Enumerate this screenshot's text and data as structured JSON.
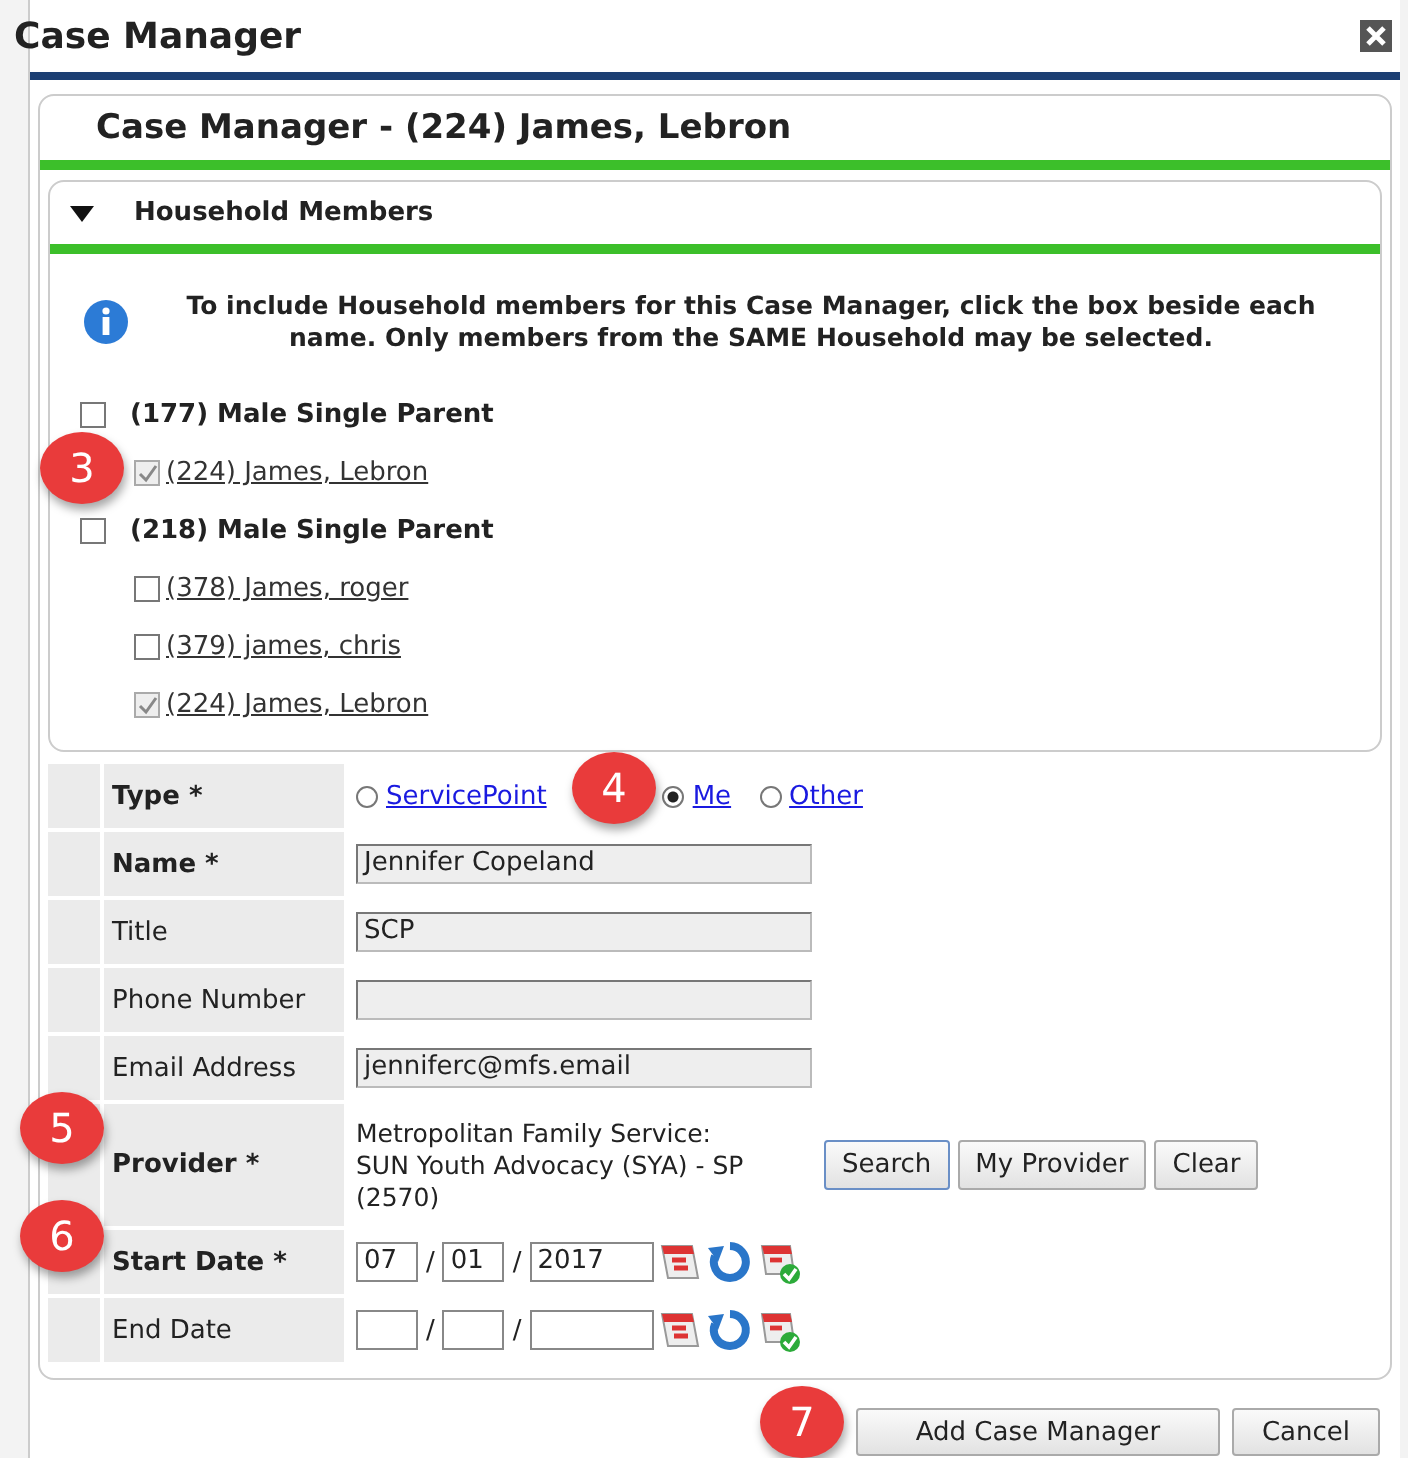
{
  "window": {
    "title": "Case Manager"
  },
  "header": "Case Manager - (224) James, Lebron",
  "household": {
    "title": "Household Members",
    "expanded": true,
    "info": "To include Household members for this Case Manager, click the box beside each name. Only members from the SAME Household may be selected.",
    "groups": [
      {
        "label": "(177) Male Single Parent",
        "checked": false,
        "members": [
          {
            "label": "(224) James, Lebron",
            "checked": true
          }
        ]
      },
      {
        "label": "(218) Male Single Parent",
        "checked": false,
        "members": [
          {
            "label": "(378) James, roger",
            "checked": false
          },
          {
            "label": "(379) james, chris",
            "checked": false
          },
          {
            "label": "(224) James, Lebron",
            "checked": true
          }
        ]
      }
    ]
  },
  "form": [
    {
      "kind": "radio",
      "label": "Type *",
      "required": true,
      "options": [
        {
          "label": "ServicePoint",
          "selected": false
        },
        {
          "label": "Me",
          "selected": true
        },
        {
          "label": "Other",
          "selected": false
        }
      ]
    },
    {
      "kind": "text",
      "label": "Name *",
      "required": true,
      "value": "Jennifer Copeland"
    },
    {
      "kind": "text",
      "label": "Title",
      "required": false,
      "value": "SCP"
    },
    {
      "kind": "text",
      "label": "Phone Number",
      "required": false
    },
    {
      "kind": "text",
      "label": "Email Address",
      "required": false,
      "value": "jenniferc@mfs.email"
    },
    {
      "kind": "provider",
      "label": "Provider *",
      "required": true,
      "value": "Metropolitan Family Service: SUN Youth Advocacy (SYA) - SP (2570)",
      "buttons": [
        {
          "label": "Search",
          "focused": true
        },
        {
          "label": "My Provider",
          "focused": false
        },
        {
          "label": "Clear",
          "focused": false
        }
      ]
    },
    {
      "kind": "date",
      "label": "Start Date *",
      "required": true,
      "month": "07",
      "day": "01",
      "year": "2017",
      "separators": [
        "/",
        "/"
      ]
    },
    {
      "kind": "date",
      "label": "End Date",
      "required": false,
      "separators": [
        "/",
        "/"
      ]
    }
  ],
  "buttons": [
    "Add Case Manager",
    "Cancel"
  ],
  "callouts": [
    "3",
    "4",
    "5",
    "6",
    "7"
  ]
}
